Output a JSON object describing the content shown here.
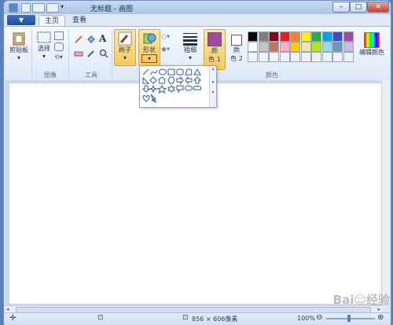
{
  "window": {
    "title": "无标题 - 画图",
    "buttons": {
      "minimize": "–",
      "maximize": "□",
      "close": "✕"
    }
  },
  "tabs": {
    "file": "▼",
    "home": "主页",
    "view": "查看"
  },
  "ribbon": {
    "clipboard": {
      "label": "剪贴板"
    },
    "image": {
      "select": "选择",
      "group": "图像"
    },
    "tools": {
      "group": "工具"
    },
    "brushes": {
      "label": "刷子"
    },
    "shapes": {
      "label": "形状"
    },
    "size": {
      "label": "粗细"
    },
    "color1": {
      "label1": "颜",
      "label2": "色 1"
    },
    "color2": {
      "label1": "颜",
      "label2": "色 2"
    },
    "colors_group": "颜色",
    "edit_colors": "编辑颜色",
    "palette": [
      "#000000",
      "#7f7f7f",
      "#880015",
      "#ed1c24",
      "#ff7f27",
      "#fff200",
      "#22b14c",
      "#00a2e8",
      "#3f48cc",
      "#a349a4",
      "#ffffff",
      "#c3c3c3",
      "#b97a57",
      "#ffaec9",
      "#ffc90e",
      "#efe4b0",
      "#b5e61d",
      "#99d9ea",
      "#7092be",
      "#c8bfe7"
    ],
    "color1_value": "#a349a4",
    "color2_value": "#ffffff"
  },
  "status": {
    "canvas_size": "856 × 606像素",
    "zoom": "100%"
  }
}
